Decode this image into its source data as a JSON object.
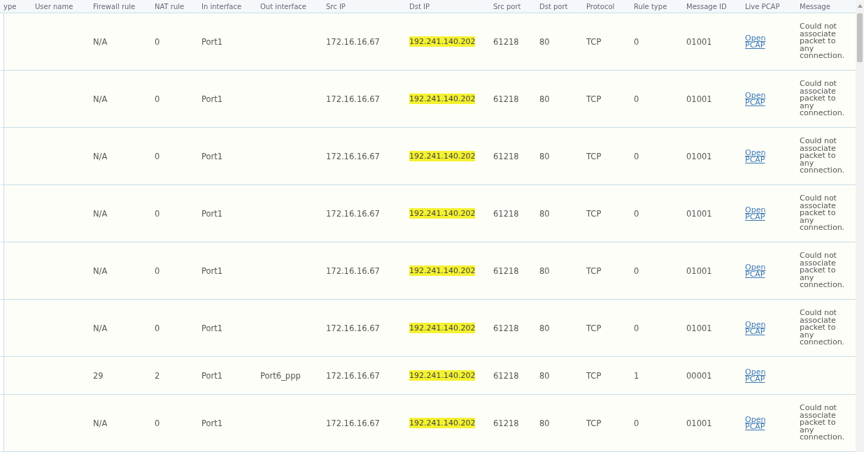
{
  "table": {
    "columns": [
      "ype",
      "User name",
      "Firewall rule",
      "NAT rule",
      "In interface",
      "Out interface",
      "Src IP",
      "Dst IP",
      "Src port",
      "Dst port",
      "Protocol",
      "Rule type",
      "Message ID",
      "Live PCAP",
      "Message"
    ],
    "rows": [
      {
        "firewall_rule": "N/A",
        "nat_rule": "0",
        "in_interface": "Port1",
        "src_ip": "172.16.16.67",
        "dst_ip": "192.241.140.202",
        "src_port": "61218",
        "dst_port": "80",
        "protocol": "TCP",
        "rule_type": "0",
        "message_id": "01001",
        "live_pcap": "Open PCAP",
        "message": "Could not associate packet to any connection."
      },
      {
        "firewall_rule": "N/A",
        "nat_rule": "0",
        "in_interface": "Port1",
        "src_ip": "172.16.16.67",
        "dst_ip": "192.241.140.202",
        "src_port": "61218",
        "dst_port": "80",
        "protocol": "TCP",
        "rule_type": "0",
        "message_id": "01001",
        "live_pcap": "Open PCAP",
        "message": "Could not associate packet to any connection."
      },
      {
        "firewall_rule": "N/A",
        "nat_rule": "0",
        "in_interface": "Port1",
        "src_ip": "172.16.16.67",
        "dst_ip": "192.241.140.202",
        "src_port": "61218",
        "dst_port": "80",
        "protocol": "TCP",
        "rule_type": "0",
        "message_id": "01001",
        "live_pcap": "Open PCAP",
        "message": "Could not associate packet to any connection."
      },
      {
        "firewall_rule": "N/A",
        "nat_rule": "0",
        "in_interface": "Port1",
        "src_ip": "172.16.16.67",
        "dst_ip": "192.241.140.202",
        "src_port": "61218",
        "dst_port": "80",
        "protocol": "TCP",
        "rule_type": "0",
        "message_id": "01001",
        "live_pcap": "Open PCAP",
        "message": "Could not associate packet to any connection."
      },
      {
        "firewall_rule": "N/A",
        "nat_rule": "0",
        "in_interface": "Port1",
        "src_ip": "172.16.16.67",
        "dst_ip": "192.241.140.202",
        "src_port": "61218",
        "dst_port": "80",
        "protocol": "TCP",
        "rule_type": "0",
        "message_id": "01001",
        "live_pcap": "Open PCAP",
        "message": "Could not associate packet to any connection."
      },
      {
        "firewall_rule": "N/A",
        "nat_rule": "0",
        "in_interface": "Port1",
        "src_ip": "172.16.16.67",
        "dst_ip": "192.241.140.202",
        "src_port": "61218",
        "dst_port": "80",
        "protocol": "TCP",
        "rule_type": "0",
        "message_id": "01001",
        "live_pcap": "Open PCAP",
        "message": "Could not associate packet to any connection."
      },
      {
        "firewall_rule": "29",
        "nat_rule": "2",
        "in_interface": "Port1",
        "out_interface": "Port6_ppp",
        "src_ip": "172.16.16.67",
        "dst_ip": "192.241.140.202",
        "src_port": "61218",
        "dst_port": "80",
        "protocol": "TCP",
        "rule_type": "1",
        "message_id": "00001",
        "live_pcap": "Open PCAP"
      },
      {
        "firewall_rule": "N/A",
        "nat_rule": "0",
        "in_interface": "Port1",
        "src_ip": "172.16.16.67",
        "dst_ip": "192.241.140.202",
        "src_port": "61218",
        "dst_port": "80",
        "protocol": "TCP",
        "rule_type": "0",
        "message_id": "01001",
        "live_pcap": "Open PCAP",
        "message": "Could not associate packet to any connection."
      }
    ]
  }
}
